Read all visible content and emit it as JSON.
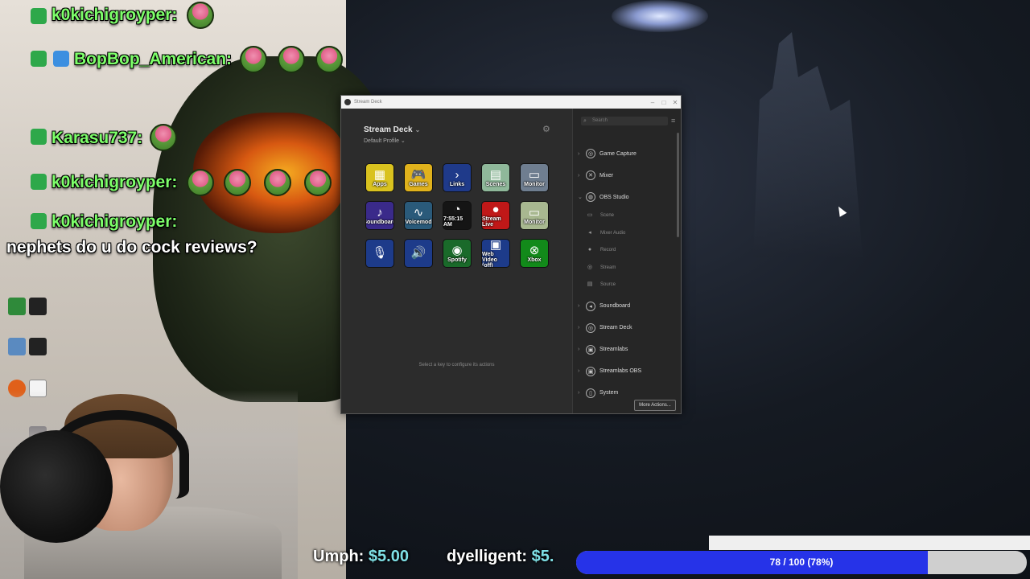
{
  "chat": [
    {
      "name": "k0kichigroyper:",
      "msg": ""
    },
    {
      "name": "BopBop_American:",
      "msg": ""
    },
    {
      "name": "Karasu737:",
      "msg": ""
    },
    {
      "name": "k0kichigroyper:",
      "msg": ""
    },
    {
      "name": "k0kichigroyper:",
      "msg": "nephets do u do cock reviews?"
    }
  ],
  "window": {
    "title": "Stream Deck",
    "deck_name": "Stream Deck",
    "profile": "Default Profile",
    "hint": "Select a key to configure its actions",
    "search_placeholder": "Search",
    "more_actions": "More Actions...",
    "keys": [
      {
        "label": "Apps",
        "glyph": "▦",
        "color": "#d9c21f",
        "icon": "apps-icon"
      },
      {
        "label": "Games",
        "glyph": "🎮",
        "color": "#e0b21c",
        "icon": "gamepad-icon"
      },
      {
        "label": "Links",
        "glyph": "›",
        "color": "#1f3a8a",
        "icon": "link-icon"
      },
      {
        "label": "Scenes",
        "glyph": "▤",
        "color": "#8fb89a",
        "icon": "scenes-icon"
      },
      {
        "label": "Monitor",
        "glyph": "▭",
        "color": "#6f7e90",
        "icon": "monitor-icon"
      },
      {
        "label": "Soundboard",
        "glyph": "♪",
        "color": "#3a2a8a",
        "icon": "music-note-icon"
      },
      {
        "label": "Voicemod",
        "glyph": "∿",
        "color": "#2a5a7a",
        "icon": "waveform-icon"
      },
      {
        "label": "7:55:15 AM",
        "glyph": "◔",
        "color": "#151515",
        "icon": "clock-icon"
      },
      {
        "label": "Stream Live",
        "glyph": "●",
        "color": "#c01818",
        "icon": "record-icon"
      },
      {
        "label": "Monitor",
        "glyph": "▭",
        "color": "#a8b890",
        "icon": "monitor-icon"
      },
      {
        "label": "",
        "glyph": "🎙",
        "color": "#1d3b8a",
        "icon": "microphone-icon"
      },
      {
        "label": "",
        "glyph": "🔊",
        "color": "#1d3b8a",
        "icon": "speaker-icon"
      },
      {
        "label": "Spotify",
        "glyph": "◉",
        "color": "#1a6a2a",
        "icon": "spotify-icon"
      },
      {
        "label": "Web Video (off)",
        "glyph": "▣",
        "color": "#1d3b8a",
        "icon": "webcam-icon"
      },
      {
        "label": "Xbox",
        "glyph": "⊗",
        "color": "#128a1a",
        "icon": "xbox-icon"
      }
    ],
    "categories": [
      {
        "label": "Game Capture",
        "glyph": "◎",
        "expanded": false,
        "icon": "game-capture-icon"
      },
      {
        "label": "Mixer",
        "glyph": "✕",
        "expanded": false,
        "icon": "mixer-icon"
      },
      {
        "label": "OBS Studio",
        "glyph": "◍",
        "expanded": true,
        "icon": "obs-icon"
      }
    ],
    "obs_sub": [
      {
        "label": "Scene",
        "glyph": "▭",
        "icon": "scene-icon"
      },
      {
        "label": "Mixer Audio",
        "glyph": "◂",
        "icon": "mixer-audio-icon"
      },
      {
        "label": "Record",
        "glyph": "●",
        "icon": "record-icon"
      },
      {
        "label": "Stream",
        "glyph": "◎",
        "icon": "stream-icon"
      },
      {
        "label": "Source",
        "glyph": "▤",
        "icon": "source-icon"
      }
    ],
    "categories_more": [
      {
        "label": "Soundboard",
        "glyph": "◂",
        "icon": "soundboard-icon"
      },
      {
        "label": "Stream Deck",
        "glyph": "◎",
        "icon": "stream-deck-icon"
      },
      {
        "label": "Streamlabs",
        "glyph": "▣",
        "icon": "streamlabs-icon"
      },
      {
        "label": "Streamlabs OBS",
        "glyph": "▣",
        "icon": "streamlabs-obs-icon"
      },
      {
        "label": "System",
        "glyph": "▯",
        "icon": "system-icon"
      }
    ]
  },
  "donations": [
    {
      "name": "Umph:",
      "amount": "$5.00"
    },
    {
      "name": "dyelligent:",
      "amount": "$5."
    }
  ],
  "goal": {
    "text": "78 / 100 (78%)",
    "progress": 0.78,
    "fill_color": "#2633e8"
  }
}
